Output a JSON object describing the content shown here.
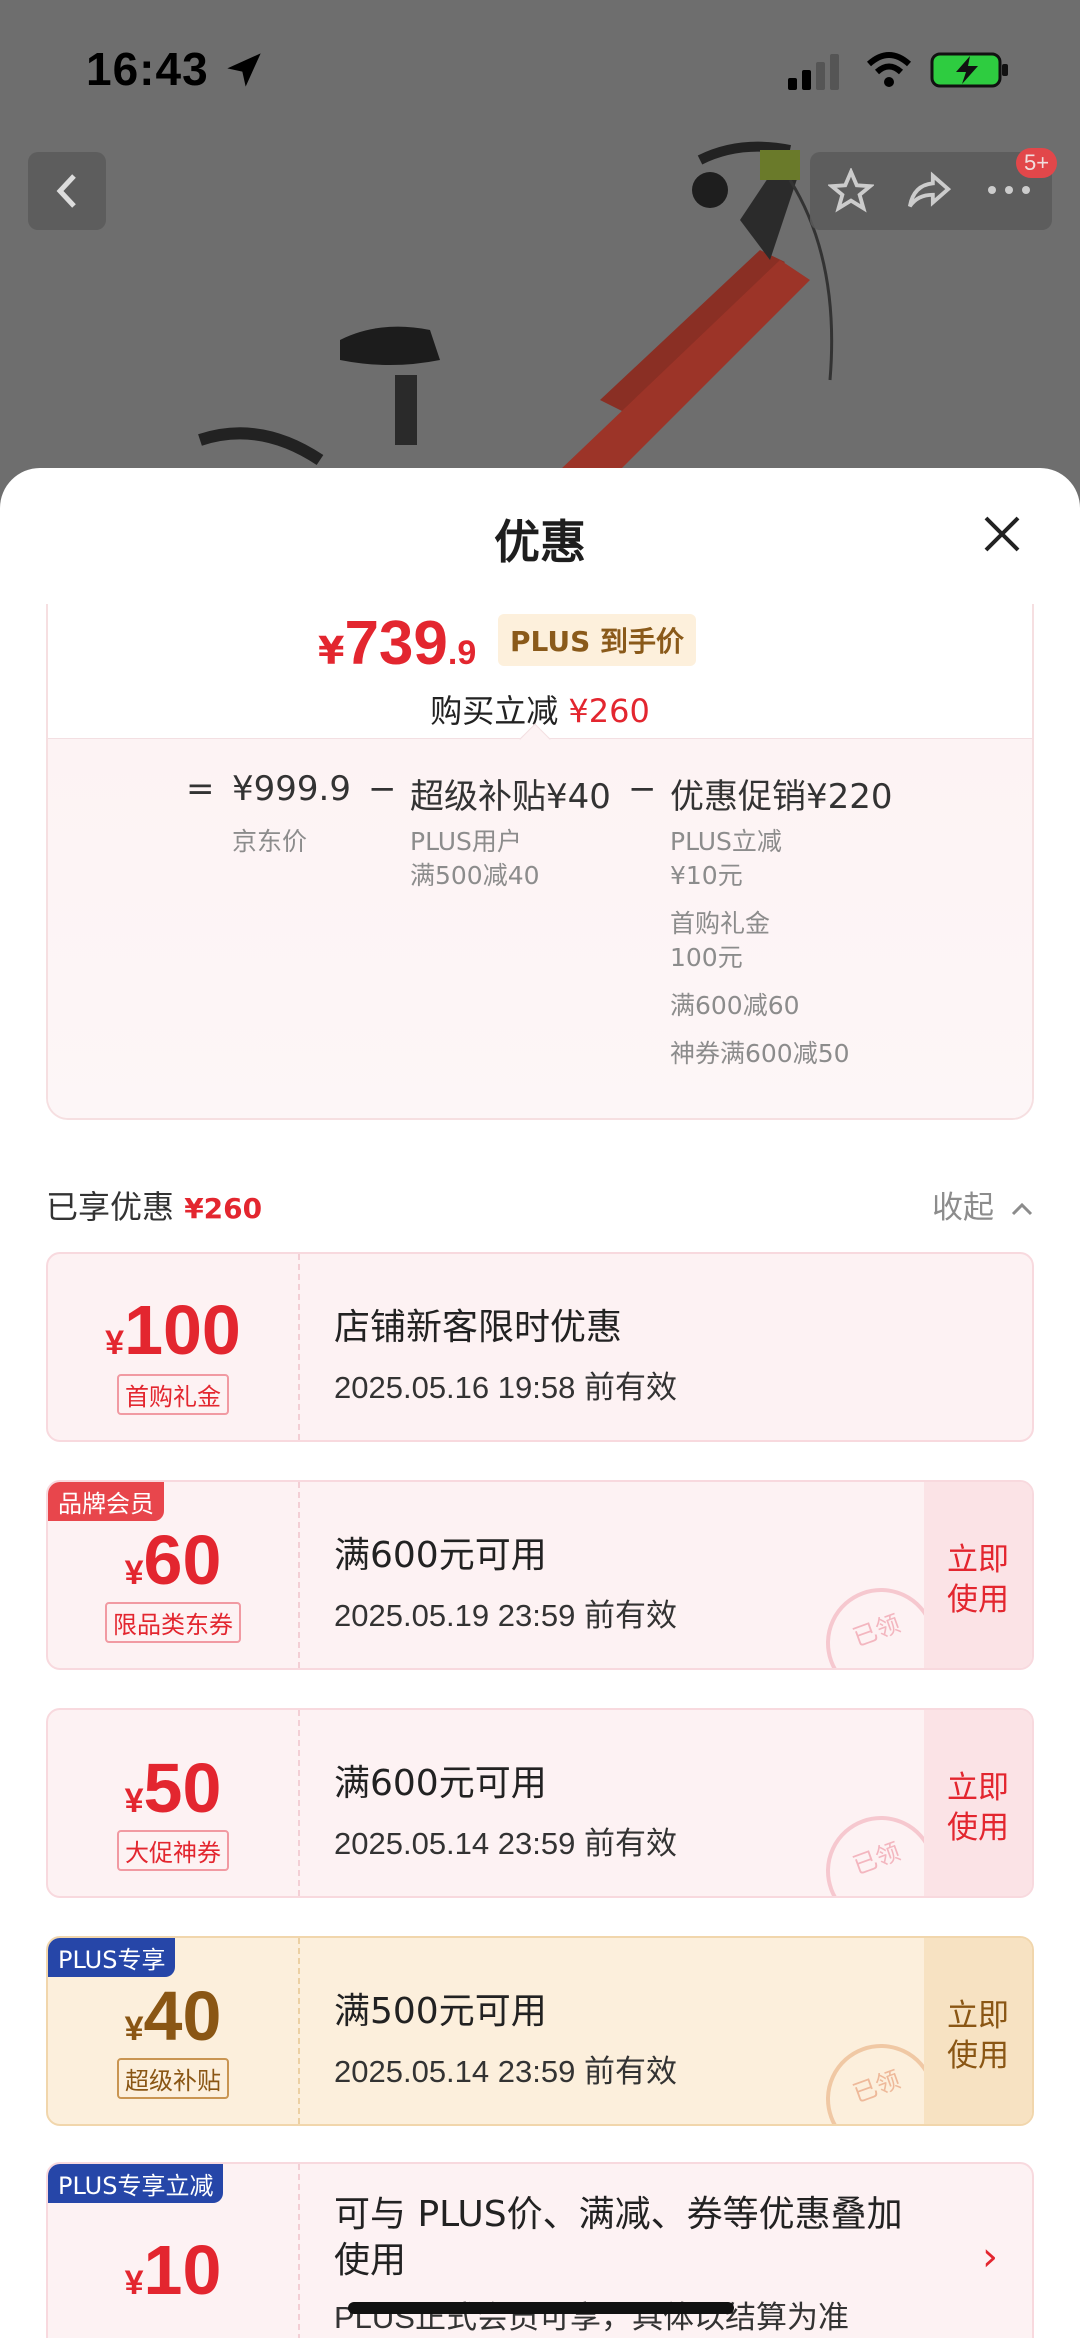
{
  "status_bar": {
    "time": "16:43"
  },
  "header": {
    "badge": "5+"
  },
  "sheet": {
    "title": "优惠",
    "price": {
      "currency": "¥",
      "integer": "739",
      "decimal": ".9",
      "tag": "PLUS 到手价"
    },
    "reduce": {
      "label": "购买立减 ",
      "amount": "¥260"
    },
    "breakdown": {
      "equals": "=",
      "base": {
        "value": "¥999.9",
        "label": "京东价"
      },
      "minus1": "−",
      "subsidy": {
        "value": "超级补贴¥40",
        "lines": [
          "PLUS用户",
          "满500减40"
        ]
      },
      "minus2": "−",
      "promo": {
        "value": "优惠促销¥220",
        "lines": [
          "PLUS立减",
          "¥10元",
          "首购礼金",
          "100元",
          "满600减60",
          "神券满600减50"
        ]
      }
    },
    "enjoyed": {
      "label": "已享优惠 ",
      "amount": "¥260"
    },
    "collapse_label": "收起",
    "coupons": [
      {
        "currency": "¥",
        "amount": "100",
        "tag": "首购礼金",
        "title": "店铺新客限时优惠",
        "date": "2025.05.16 19:58 前有效"
      },
      {
        "ribbon": "品牌会员",
        "currency": "¥",
        "amount": "60",
        "tag": "限品类东券",
        "title": "满600元可用",
        "date": "2025.05.19 23:59 前有效",
        "action": "立即使用",
        "stamp": "已领"
      },
      {
        "currency": "¥",
        "amount": "50",
        "tag": "大促神券",
        "title": "满600元可用",
        "date": "2025.05.14 23:59 前有效",
        "action": "立即使用",
        "stamp": "已领"
      },
      {
        "ribbon": "PLUS专享",
        "currency": "¥",
        "amount": "40",
        "tag": "超级补贴",
        "title": "满500元可用",
        "date": "2025.05.14 23:59 前有效",
        "action": "立即使用",
        "stamp": "已领"
      },
      {
        "ribbon": "PLUS专享立减",
        "currency": "¥",
        "amount": "10",
        "title_lines": [
          "可与 PLUS价、满减、券等优惠叠加",
          "使用"
        ],
        "note": "PLUS正式会员可享，具体以结算为准"
      }
    ]
  },
  "colors": {
    "accent_red": "#e3262f",
    "gold": "#8a5614",
    "plus_blue": "#2646a8"
  }
}
